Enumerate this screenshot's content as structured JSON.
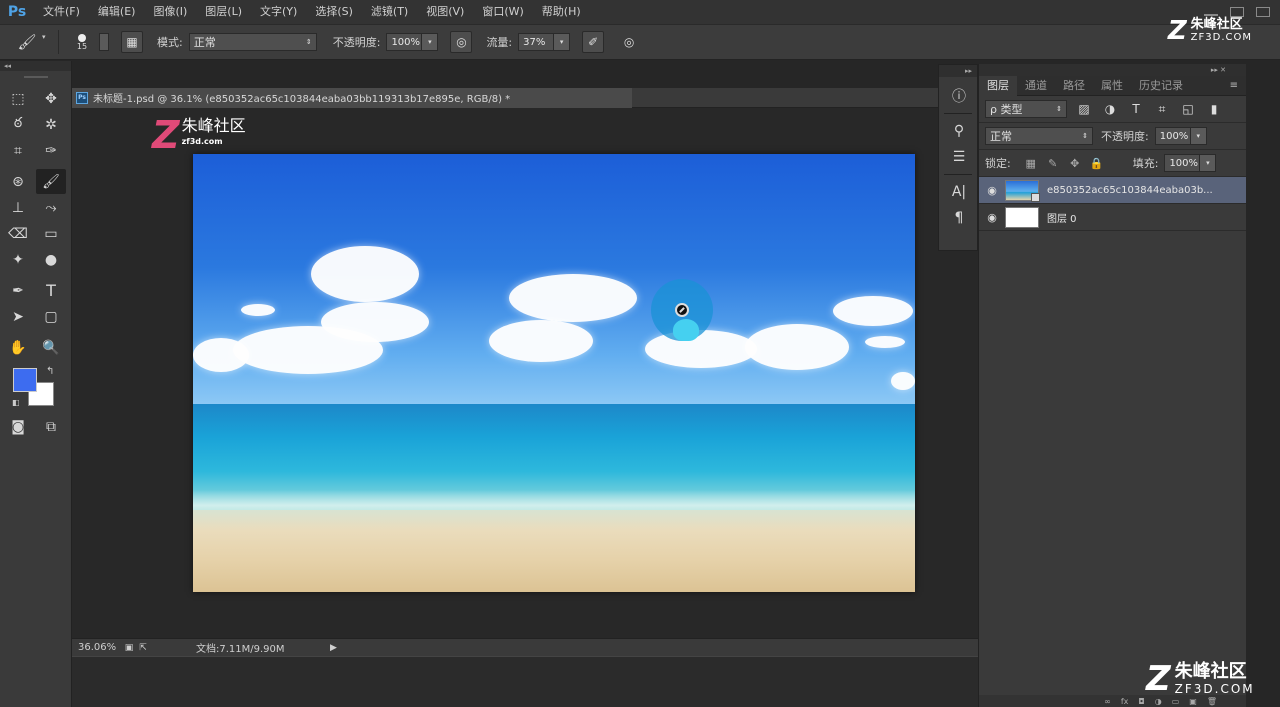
{
  "menubar": {
    "logo": "Ps",
    "items": [
      "文件(F)",
      "编辑(E)",
      "图像(I)",
      "图层(L)",
      "文字(Y)",
      "选择(S)",
      "滤镜(T)",
      "视图(V)",
      "窗口(W)",
      "帮助(H)"
    ]
  },
  "options": {
    "brush_size": "15",
    "mode_label": "模式:",
    "mode_value": "正常",
    "opacity_label": "不透明度:",
    "opacity_value": "100%",
    "flow_label": "流量:",
    "flow_value": "37%"
  },
  "document": {
    "badge": "Ps",
    "title": "未标题-1.psd @ 36.1% (e850352ac65c103844eaba03bb119313b17e895e, RGB/8) *",
    "zoom": "36.06%",
    "doc_info": "文档:7.11M/9.90M"
  },
  "colors": {
    "foreground": "#3d6cf0",
    "background": "#ffffff"
  },
  "layers_panel": {
    "tabs": [
      "图层",
      "通道",
      "路径",
      "属性",
      "历史记录"
    ],
    "active_tab": 0,
    "filter_label": "ρ 类型",
    "blend_mode": "正常",
    "opacity_label": "不透明度:",
    "opacity_value": "100%",
    "lock_label": "锁定:",
    "fill_label": "填充:",
    "fill_value": "100%",
    "layers": [
      {
        "name": "e850352ac65c103844eaba03b...",
        "selected": true,
        "thumb": "image"
      },
      {
        "name": "图层 0",
        "selected": false,
        "thumb": "white"
      }
    ]
  },
  "watermark": {
    "logo_letter": "Z",
    "name_cn": "朱峰社区",
    "name_en": "ZF3D.COM",
    "canvas_en": "zf3d.com"
  }
}
